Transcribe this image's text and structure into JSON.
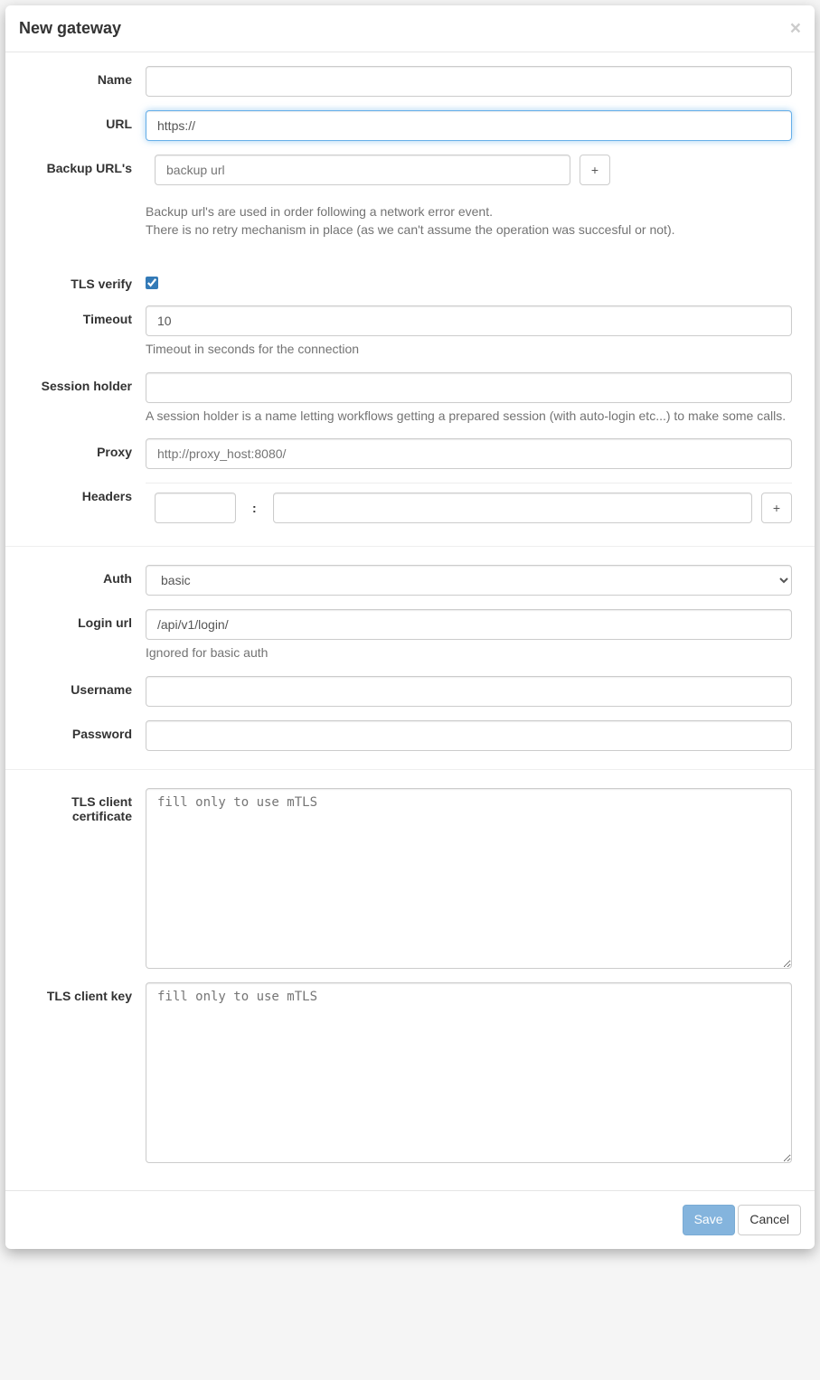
{
  "modal": {
    "title": "New gateway",
    "close_label": "×"
  },
  "form": {
    "name": {
      "label": "Name",
      "value": ""
    },
    "url": {
      "label": "URL",
      "value": "https://"
    },
    "backup_urls": {
      "label": "Backup URL's",
      "items": [
        {
          "value": "",
          "placeholder": "backup url"
        }
      ],
      "add_label": "+",
      "help_line1": "Backup url's are used in order following a network error event.",
      "help_line2": "There is no retry mechanism in place (as we can't assume the operation was succesful or not)."
    },
    "tls_verify": {
      "label": "TLS verify",
      "checked": true
    },
    "timeout": {
      "label": "Timeout",
      "value": "10",
      "help": "Timeout in seconds for the connection"
    },
    "session_holder": {
      "label": "Session holder",
      "value": "",
      "help": "A session holder is a name letting workflows getting a prepared session (with auto-login etc...) to make some calls."
    },
    "proxy": {
      "label": "Proxy",
      "value": "",
      "placeholder": "http://proxy_host:8080/"
    },
    "headers": {
      "label": "Headers",
      "separator": ":",
      "add_label": "+",
      "items": [
        {
          "key": "",
          "value": ""
        }
      ]
    },
    "auth": {
      "label": "Auth",
      "value": "basic",
      "options": [
        "basic"
      ]
    },
    "login_url": {
      "label": "Login url",
      "value": "/api/v1/login/",
      "help": "Ignored for basic auth"
    },
    "username": {
      "label": "Username",
      "value": ""
    },
    "password": {
      "label": "Password",
      "value": ""
    },
    "tls_client_cert": {
      "label": "TLS client certificate",
      "value": "",
      "placeholder": "fill only to use mTLS"
    },
    "tls_client_key": {
      "label": "TLS client key",
      "value": "",
      "placeholder": "fill only to use mTLS"
    }
  },
  "footer": {
    "save_label": "Save",
    "cancel_label": "Cancel"
  }
}
